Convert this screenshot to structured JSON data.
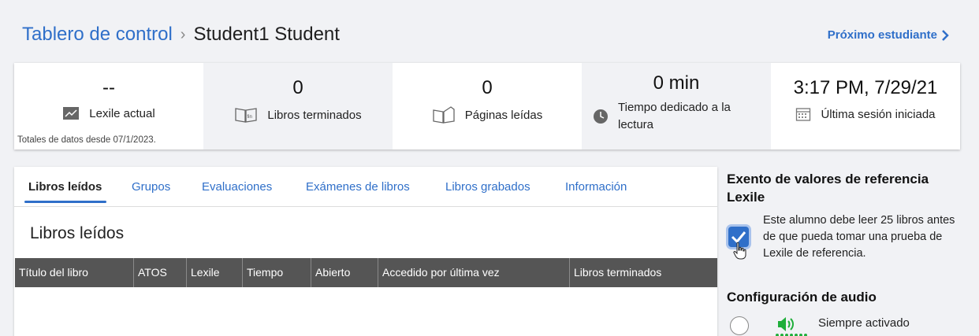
{
  "breadcrumb": {
    "root": "Tablero de control",
    "separator": "›",
    "current": "Student1 Student"
  },
  "next_student": "Próximo estudiante",
  "stats": {
    "lexile": {
      "value": "--",
      "label": "Lexile actual",
      "icon": "line-chart-icon"
    },
    "books": {
      "value": "0",
      "label": "Libros terminados",
      "icon": "book-fin-icon"
    },
    "pages": {
      "value": "0",
      "label": "Páginas leídas",
      "icon": "open-book-icon"
    },
    "time": {
      "value": "0 min",
      "label": "Tiempo dedicado a la lectura",
      "icon": "clock-icon"
    },
    "session": {
      "value": "3:17 PM, 7/29/21",
      "label": "Última sesión iniciada",
      "icon": "calendar-icon"
    },
    "note": "Totales de datos desde 07/1/2023."
  },
  "tabs": [
    {
      "label": "Libros leídos",
      "active": true
    },
    {
      "label": "Grupos",
      "active": false
    },
    {
      "label": "Evaluaciones",
      "active": false
    },
    {
      "label": "Exámenes de libros",
      "active": false
    },
    {
      "label": "Libros grabados",
      "active": false
    },
    {
      "label": "Información",
      "active": false
    }
  ],
  "section_title": "Libros leídos",
  "table": {
    "columns": [
      "Título del libro",
      "ATOS",
      "Lexile",
      "Tiempo",
      "Abierto",
      "Accedido por última vez",
      "Libros terminados"
    ],
    "rows": []
  },
  "exempt": {
    "title": "Exento de valores de referencia Lexile",
    "text": "Este alumno debe leer 25 libros antes de que pueda tomar una prueba de Lexile de referencia.",
    "checked": true
  },
  "audio": {
    "title": "Configuración de audio",
    "option_label": "Siempre activado",
    "selected": false
  },
  "colors": {
    "accent": "#2f6fc9",
    "header_bg": "#555555",
    "audio_green": "#1fae3a"
  }
}
